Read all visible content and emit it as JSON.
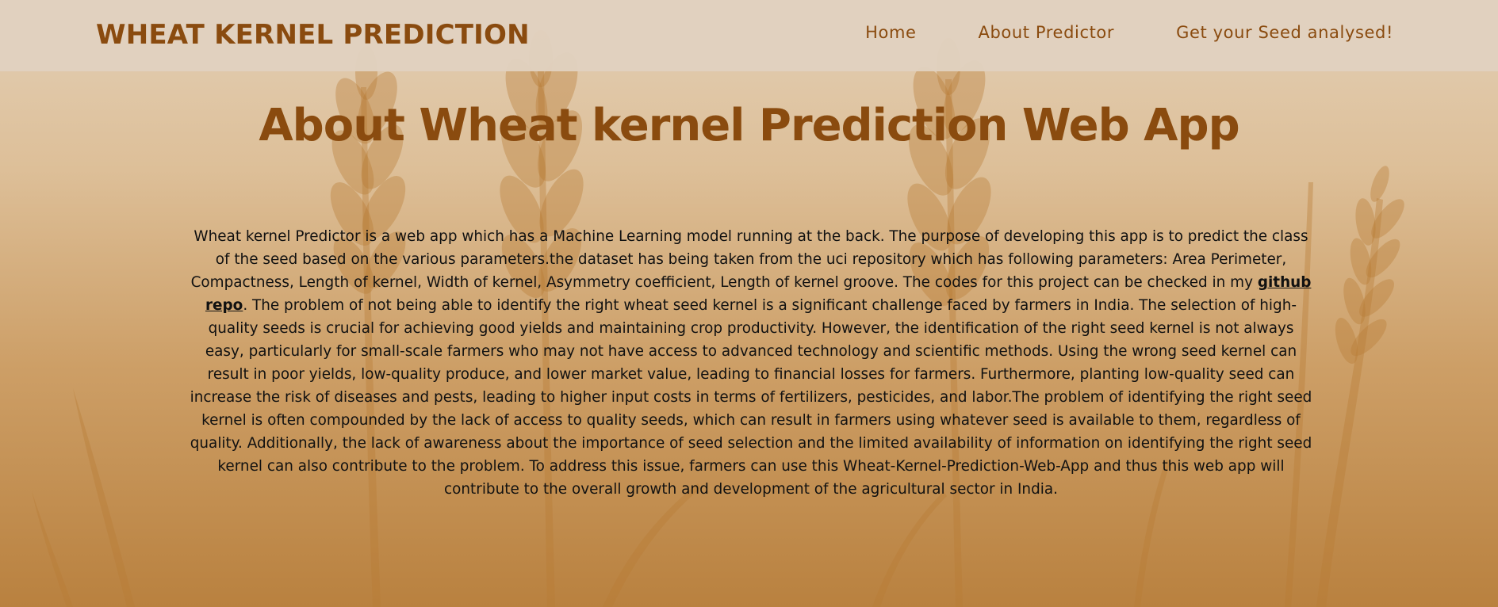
{
  "navbar": {
    "brand": "WHEAT KERNEL PREDICTION",
    "links": [
      "Home",
      "About Predictor",
      "Get your Seed analysed!"
    ]
  },
  "main": {
    "title": "About Wheat kernel Prediction Web App",
    "paragraph_before_link": "Wheat kernel Predictor is a web app which has a Machine Learning model running at the back. The purpose of developing this app is to predict the class of the seed based on the various parameters.the dataset has being taken from the uci repository which has following parameters: Area Perimeter, Compactness, Length of kernel, Width of kernel, Asymmetry coefficient, Length of kernel groove. The codes for this project can be checked in my ",
    "link_text": "github repo",
    "paragraph_after_link": ". The problem of not being able to identify the right wheat seed kernel is a significant challenge faced by farmers in India. The selection of high-quality seeds is crucial for achieving good yields and maintaining crop productivity. However, the identification of the right seed kernel is not always easy, particularly for small-scale farmers who may not have access to advanced technology and scientific methods. Using the wrong seed kernel can result in poor yields, low-quality produce, and lower market value, leading to financial losses for farmers. Furthermore, planting low-quality seed can increase the risk of diseases and pests, leading to higher input costs in terms of fertilizers, pesticides, and labor.The problem of identifying the right seed kernel is often compounded by the lack of access to quality seeds, which can result in farmers using whatever seed is available to them, regardless of quality. Additionally, the lack of awareness about the importance of seed selection and the limited availability of information on identifying the right seed kernel can also contribute to the problem. To address this issue, farmers can use this Wheat-Kernel-Prediction-Web-App and thus this web app will contribute to the overall growth and development of the agricultural sector in India."
  },
  "colors": {
    "brand": "#8a4b0f",
    "navbar_bg": "#e1d1bf",
    "bg_top": "#e3cfb6",
    "bg_bottom": "#b9813f",
    "wheat_art": "#b87c34"
  }
}
